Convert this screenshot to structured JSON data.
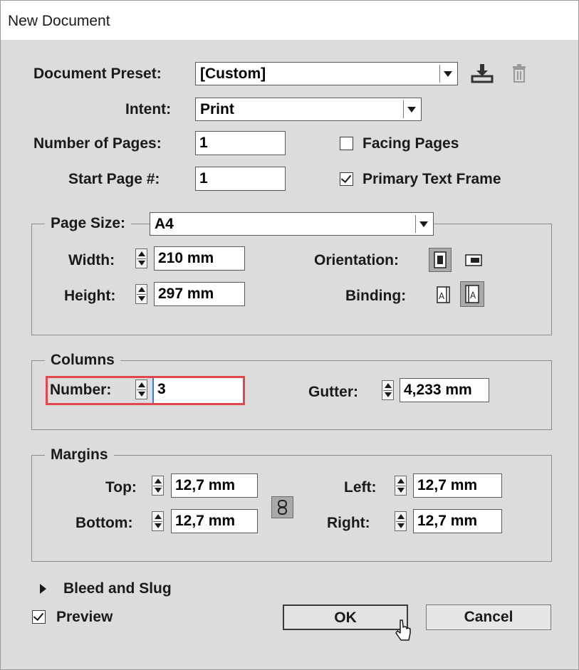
{
  "window": {
    "title": "New Document"
  },
  "preset": {
    "label": "Document Preset:",
    "value": "[Custom]",
    "save_icon": "save-preset-icon",
    "delete_icon": "delete-preset-icon"
  },
  "intent": {
    "label": "Intent:",
    "value": "Print"
  },
  "pages": {
    "label": "Number of Pages:",
    "value": "1",
    "facing_label": "Facing Pages",
    "facing_checked": false
  },
  "start_page": {
    "label": "Start Page #:",
    "value": "1",
    "primary_label": "Primary Text Frame",
    "primary_checked": true
  },
  "page_size": {
    "label": "Page Size:",
    "value": "A4",
    "width_label": "Width:",
    "width": "210 mm",
    "height_label": "Height:",
    "height": "297 mm",
    "orientation_label": "Orientation:",
    "orientation_selected": "portrait",
    "binding_label": "Binding:",
    "binding_selected": "right-to-left"
  },
  "columns": {
    "legend": "Columns",
    "number_label": "Number:",
    "number": "3",
    "gutter_label": "Gutter:",
    "gutter": "4,233 mm"
  },
  "margins": {
    "legend": "Margins",
    "top_label": "Top:",
    "top": "12,7 mm",
    "bottom_label": "Bottom:",
    "bottom": "12,7 mm",
    "left_label": "Left:",
    "left": "12,7 mm",
    "right_label": "Right:",
    "right": "12,7 mm",
    "link_icon": "link-chain-icon"
  },
  "bleed": {
    "label": "Bleed and Slug",
    "expanded": false
  },
  "preview": {
    "label": "Preview",
    "checked": true
  },
  "buttons": {
    "ok": "OK",
    "cancel": "Cancel"
  },
  "colors": {
    "dialog_bg": "#dcdcdc",
    "highlight": "#e0474c",
    "field_bg": "#ffffff"
  }
}
